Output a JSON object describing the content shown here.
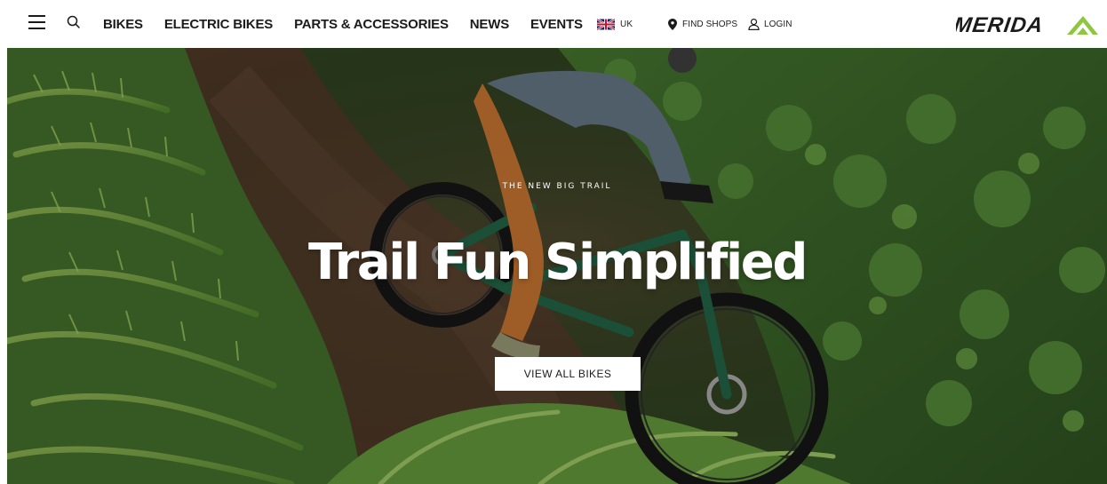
{
  "header": {
    "menu_icon": "hamburger-menu-icon",
    "search_icon": "search-icon",
    "nav": [
      {
        "label": "BIKES"
      },
      {
        "label": "ELECTRIC BIKES"
      },
      {
        "label": "PARTS & ACCESSORIES"
      },
      {
        "label": "NEWS"
      },
      {
        "label": "EVENTS"
      }
    ],
    "region": {
      "label": "UK",
      "icon": "uk-flag-icon"
    },
    "find_shops": {
      "label": "FIND SHOPS",
      "icon": "location-pin-icon"
    },
    "login": {
      "label": "LOGIN",
      "icon": "user-icon"
    },
    "logo": {
      "text": "MERIDA",
      "icon": "merida-mountain-logo",
      "accent": "#8dc63f"
    }
  },
  "hero": {
    "eyebrow": "THE NEW BIG TRAIL",
    "title": "Trail Fun Simplified",
    "cta_label": "VIEW ALL BIKES"
  },
  "colors": {
    "text": "#1b1b1b",
    "background": "#ffffff",
    "brand_green": "#8dc63f",
    "foliage_dark": "#2f4a22",
    "bike_frame": "#1f5a3f"
  }
}
